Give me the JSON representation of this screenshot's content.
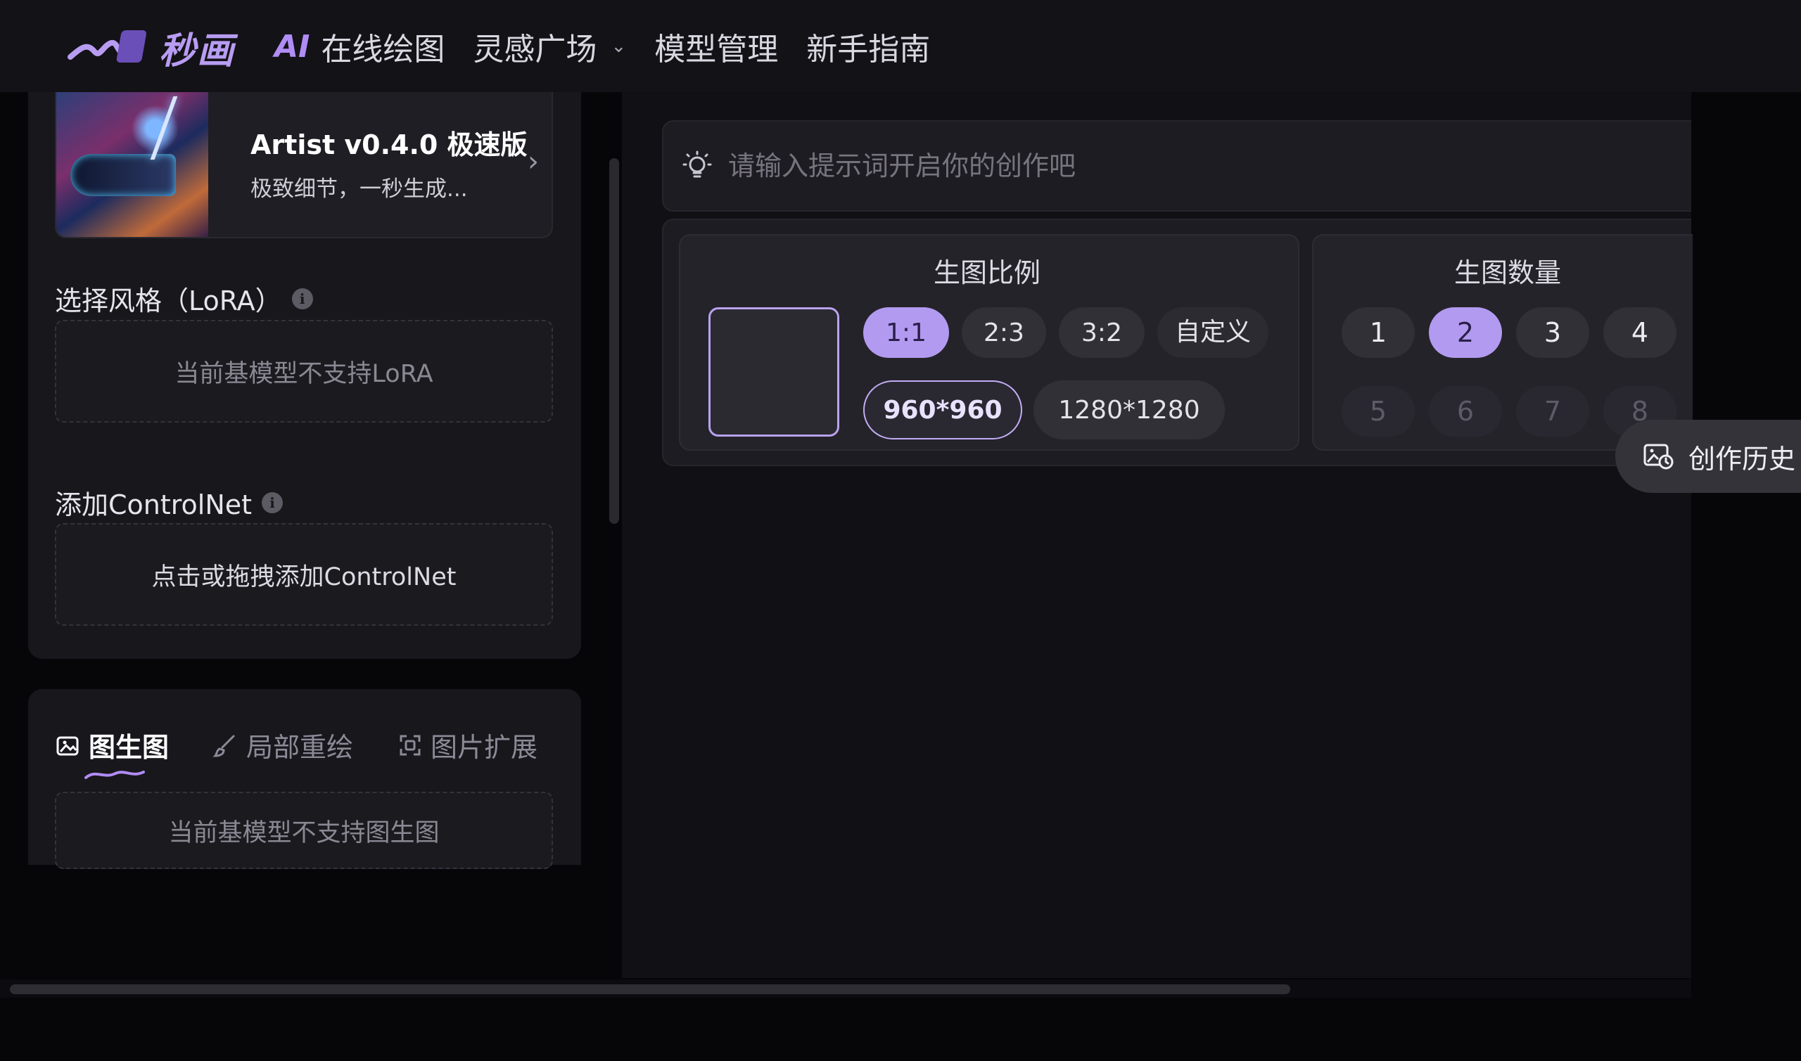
{
  "header": {
    "logo_text": "秒画",
    "nav": {
      "ai_prefix": "AI",
      "online_draw": "在线绘图",
      "inspiration": "灵感广场",
      "model_manage": "模型管理",
      "guide": "新手指南"
    }
  },
  "sidebar": {
    "model": {
      "title": "Artist v0.4.0 极速版",
      "description": "极致细节，一秒生成..."
    },
    "lora": {
      "label": "选择风格（LoRA）",
      "empty_text": "当前基模型不支持LoRA"
    },
    "controlnet": {
      "label": "添加ControlNet",
      "add_text": "点击或拖拽添加ControlNet"
    },
    "tabs": [
      {
        "label": "图生图",
        "active": true
      },
      {
        "label": "局部重绘",
        "active": false
      },
      {
        "label": "图片扩展",
        "active": false
      }
    ],
    "img2img_empty": "当前基模型不支持图生图"
  },
  "prompt": {
    "placeholder": "请输入提示词开启你的创作吧",
    "value": ""
  },
  "ratio": {
    "title": "生图比例",
    "options": [
      "1:1",
      "2:3",
      "3:2",
      "自定义"
    ],
    "selected": "1:1",
    "resolutions": [
      "960*960",
      "1280*1280"
    ],
    "selected_resolution": "960*960"
  },
  "count": {
    "title": "生图数量",
    "options": [
      "1",
      "2",
      "3",
      "4",
      "5",
      "6",
      "7",
      "8"
    ],
    "selected": "2",
    "disabled": [
      "5",
      "6",
      "7",
      "8"
    ]
  },
  "history_button": "创作历史",
  "colors": {
    "accent": "#b29af0",
    "background": "#111015",
    "panel": "#18171c"
  }
}
